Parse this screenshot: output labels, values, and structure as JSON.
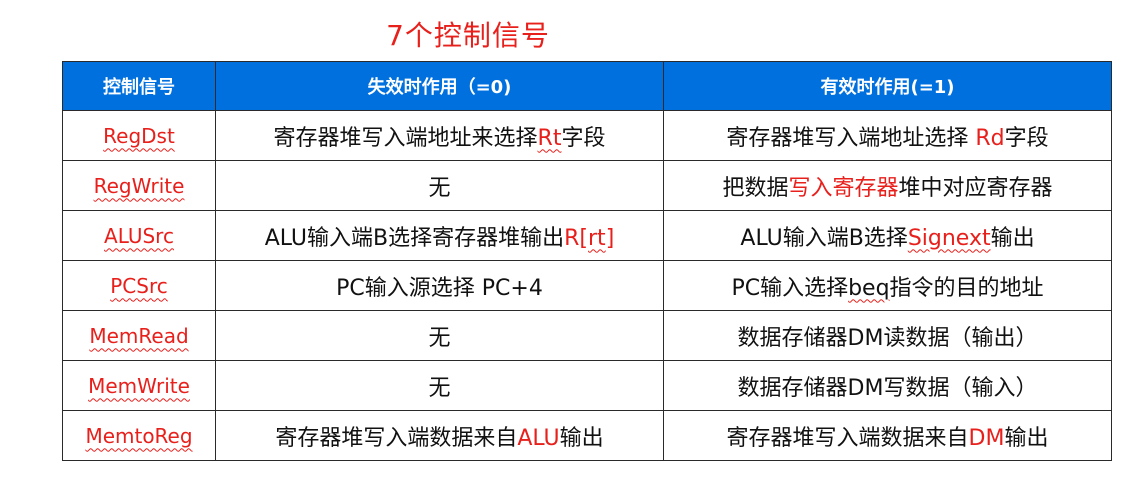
{
  "title": "7个控制信号",
  "headers": {
    "signal": "控制信号",
    "invalid": "失效时作用（=0)",
    "valid": "有效时作用(=1)"
  },
  "rows": [
    {
      "name": "RegDst",
      "invalid": [
        {
          "t": "寄存器堆写入端地址来选择"
        },
        {
          "t": "Rt",
          "hl": true,
          "wavy": true
        },
        {
          "t": "字段"
        }
      ],
      "valid": [
        {
          "t": "寄存器堆写入端地址选择 "
        },
        {
          "t": "Rd",
          "hl": true
        },
        {
          "t": "字段"
        }
      ]
    },
    {
      "name": "RegWrite",
      "invalid": [
        {
          "t": "无"
        }
      ],
      "valid": [
        {
          "t": "把数据"
        },
        {
          "t": "写入寄存器",
          "hl": true
        },
        {
          "t": "堆中对应寄存器"
        }
      ]
    },
    {
      "name": "ALUSrc",
      "invalid": [
        {
          "t": "ALU输入端B选择寄存器堆输出"
        },
        {
          "t": "R[",
          "hl": true
        },
        {
          "t": "rt",
          "hl": true,
          "wavy": true
        },
        {
          "t": "]",
          "hl": true
        }
      ],
      "valid": [
        {
          "t": "ALU输入端B选择"
        },
        {
          "t": "Signext",
          "hl": true,
          "wavy": true
        },
        {
          "t": "输出"
        }
      ]
    },
    {
      "name": "PCSrc",
      "invalid": [
        {
          "t": "PC输入源选择 PC+4"
        }
      ],
      "valid": [
        {
          "t": "PC输入选择"
        },
        {
          "t": "beq",
          "wavy": true
        },
        {
          "t": "指令的目的地址"
        }
      ]
    },
    {
      "name": "MemRead",
      "invalid": [
        {
          "t": "无"
        }
      ],
      "valid": [
        {
          "t": "数据存储器DM读数据（输出）"
        }
      ]
    },
    {
      "name": "MemWrite",
      "invalid": [
        {
          "t": "无"
        }
      ],
      "valid": [
        {
          "t": "数据存储器DM写数据（输入）"
        }
      ]
    },
    {
      "name": "MemtoReg",
      "invalid": [
        {
          "t": "寄存器堆写入端数据来自"
        },
        {
          "t": "ALU",
          "hl": true
        },
        {
          "t": "输出"
        }
      ],
      "valid": [
        {
          "t": "寄存器堆写入端数据来自"
        },
        {
          "t": "DM",
          "hl": true
        },
        {
          "t": "输出"
        }
      ]
    }
  ]
}
